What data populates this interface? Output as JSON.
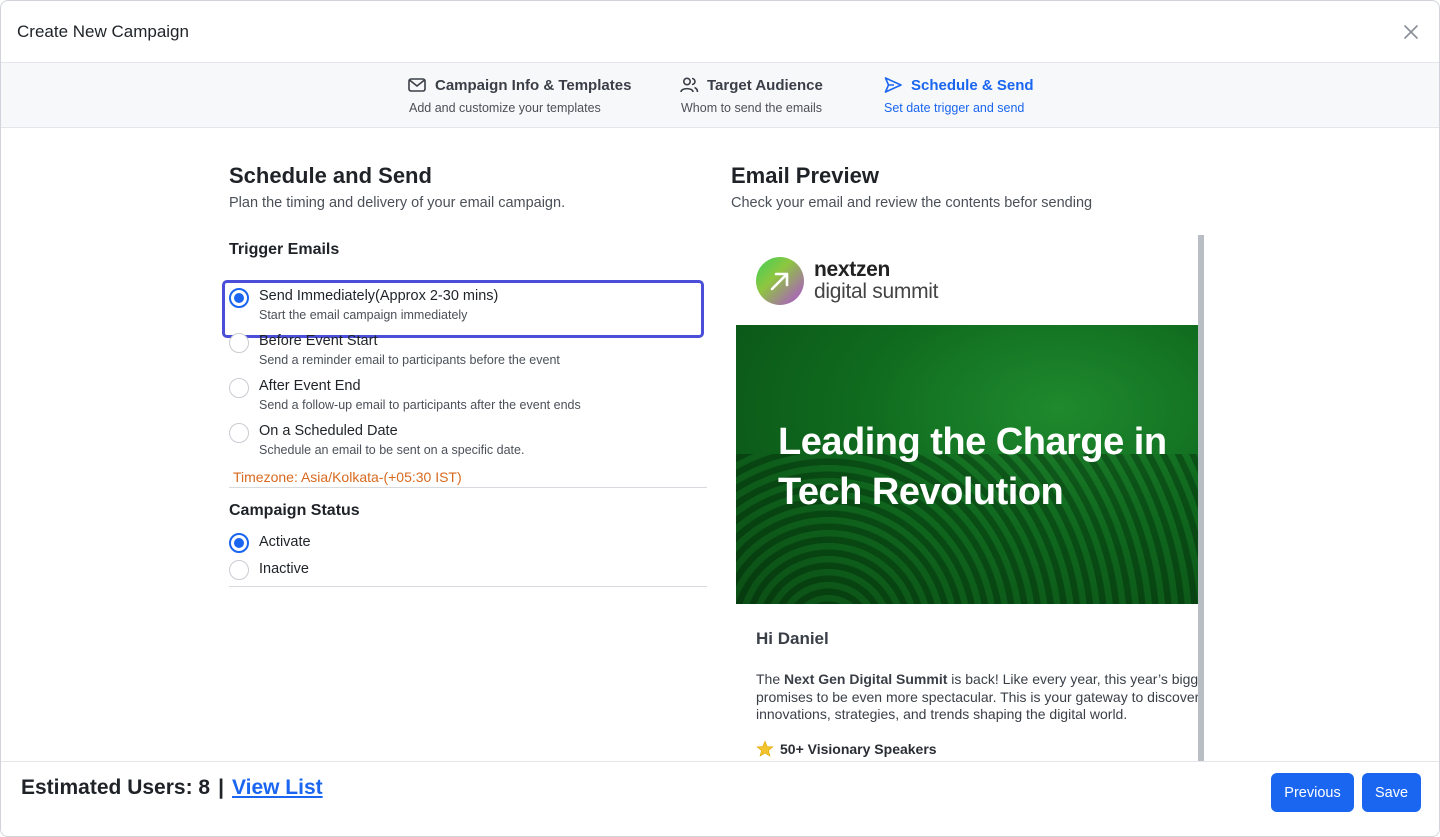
{
  "modal": {
    "title": "Create New Campaign",
    "close_icon": "close-icon"
  },
  "steps": [
    {
      "title": "Campaign Info & Templates",
      "subtitle": "Add and customize your templates",
      "icon": "mail-icon",
      "active": false
    },
    {
      "title": "Target Audience",
      "subtitle": "Whom to send the emails",
      "icon": "users-icon",
      "active": false
    },
    {
      "title": "Schedule & Send",
      "subtitle": "Set date trigger and send",
      "icon": "send-icon",
      "active": true
    }
  ],
  "schedule": {
    "title": "Schedule and Send",
    "subtitle": "Plan the timing and delivery of your email campaign.",
    "trigger_title": "Trigger Emails",
    "triggers": [
      {
        "label": "Send Immediately(Approx 2-30 mins)",
        "desc": "Start the email campaign immediately",
        "checked": true
      },
      {
        "label": "Before Event Start",
        "desc": "Send a reminder email to participants before the event",
        "checked": false
      },
      {
        "label": "After Event End",
        "desc": "Send a follow-up email to participants after the event ends",
        "checked": false
      },
      {
        "label": "On a Scheduled Date",
        "desc": "Schedule an email to be sent on a specific date.",
        "checked": false
      }
    ],
    "timezone": "Timezone: Asia/Kolkata-(+05:30 IST)",
    "status_title": "Campaign Status",
    "statuses": [
      {
        "label": "Activate",
        "checked": true
      },
      {
        "label": "Inactive",
        "checked": false
      }
    ]
  },
  "preview": {
    "title": "Email Preview",
    "subtitle": "Check your email and review the contents befor sending",
    "logo_name": "nextzen",
    "logo_sub": "digital summit",
    "banner_line1": "Leading the Charge in",
    "banner_line2": "Tech Revolution",
    "greeting": "Hi Daniel",
    "body_prefix": "The ",
    "body_bold": "Next Gen Digital Summit",
    "body_rest": " is back! Like every year, this year’s bigg",
    "body_line2": "promises to be even more spectacular. This is your gateway to discover",
    "body_line3": "innovations, strategies, and trends shaping the digital world.",
    "speakers": "50+ Visionary Speakers",
    "speakers_icon": "star-icon"
  },
  "footer": {
    "estimated_label": "Estimated Users: 8",
    "separator": "|",
    "view_list": "View List",
    "previous": "Previous",
    "save": "Save"
  },
  "colors": {
    "accent": "#1a66f0",
    "timezone": "#d8691e",
    "focus": "#4a4ed8"
  }
}
